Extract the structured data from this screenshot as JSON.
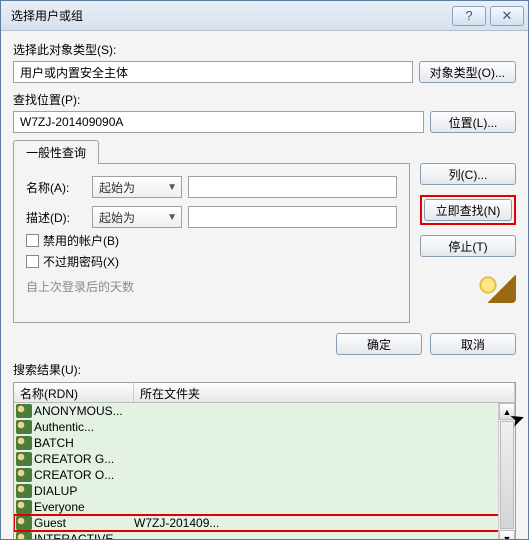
{
  "titlebar": {
    "title": "选择用户或组"
  },
  "section1": {
    "object_type_label": "选择此对象类型(S):",
    "object_type_value": "用户或内置安全主体",
    "object_type_button": "对象类型(O)...",
    "location_label": "查找位置(P):",
    "location_value": "W7ZJ-201409090A",
    "location_button": "位置(L)..."
  },
  "tabs": {
    "general_label": "一般性查询"
  },
  "query": {
    "name_label": "名称(A):",
    "name_mode": "起始为",
    "desc_label": "描述(D):",
    "desc_mode": "起始为",
    "chk_disabled": "禁用的帐户(B)",
    "chk_noexpire": "不过期密码(X)",
    "days_label": "自上次登录后的天数"
  },
  "sidebtns": {
    "columns": "列(C)...",
    "find_now": "立即查找(N)",
    "stop": "停止(T)"
  },
  "bottom": {
    "ok": "确定",
    "cancel": "取消"
  },
  "results": {
    "label": "搜索结果(U):",
    "col_name": "名称(RDN)",
    "col_folder": "所在文件夹",
    "rows": [
      {
        "name": "ANONYMOUS...",
        "folder": ""
      },
      {
        "name": "Authentic...",
        "folder": ""
      },
      {
        "name": "BATCH",
        "folder": ""
      },
      {
        "name": "CREATOR G...",
        "folder": ""
      },
      {
        "name": "CREATOR O...",
        "folder": ""
      },
      {
        "name": "DIALUP",
        "folder": ""
      },
      {
        "name": "Everyone",
        "folder": ""
      },
      {
        "name": "Guest",
        "folder": "W7ZJ-201409..."
      },
      {
        "name": "INTERACTIVE",
        "folder": ""
      }
    ],
    "highlight_index": 7
  }
}
